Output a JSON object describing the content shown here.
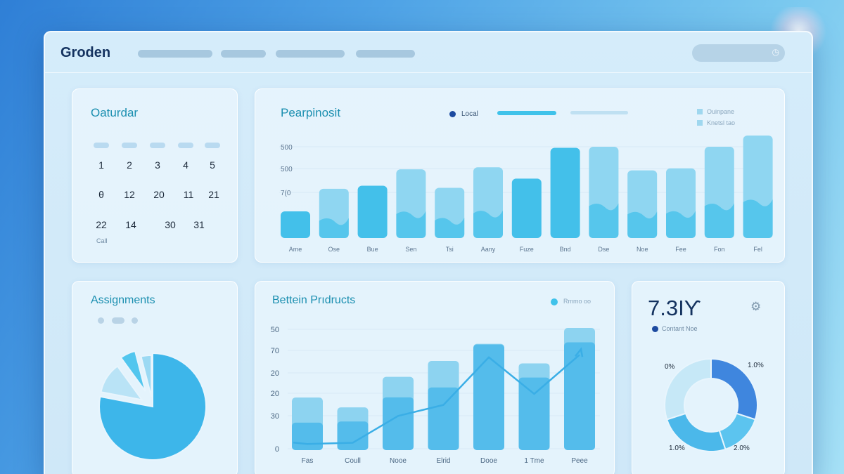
{
  "app": {
    "brand": "Groden"
  },
  "colors": {
    "accent": "#3fc2ea",
    "dark_dot": "#1c4aa0",
    "bar_light": "#8fd6f1",
    "bar_dark": "#43c0ea"
  },
  "calendar": {
    "title": "Oaturdar",
    "rows": [
      [
        "1",
        "2",
        "3",
        "4",
        "5"
      ],
      [
        "θ",
        "12",
        "20",
        "11",
        "21"
      ],
      [
        "22",
        "14",
        "30",
        "31"
      ]
    ],
    "footer": "Call"
  },
  "performance": {
    "title": "Pearpinosit",
    "legend_label": "Local",
    "legend_right": [
      "Ouinpane",
      "Knetsl tao"
    ]
  },
  "assignments": {
    "title": "Assignments"
  },
  "products": {
    "title": "Bettein Prıdructs",
    "legend_label": "Rmmo oo"
  },
  "stat": {
    "value": "7.3IƳ",
    "sublabel": "Contant Noe",
    "icon": "settings-icon",
    "donut_labels": {
      "top_left": "0%",
      "top_right": "1.0%",
      "bottom_left": "1.0%",
      "bottom_right": "2.0%"
    }
  },
  "chart_data": [
    {
      "type": "bar",
      "title": "Pearpinosit",
      "categories": [
        "Ame",
        "Ose",
        "Bue",
        "Sen",
        "Tsi",
        "Aany",
        "Fuze",
        "Bnd",
        "Dse",
        "Noe",
        "Fee",
        "Fon",
        "Fel"
      ],
      "y_tick_labels": [
        "500",
        "500",
        "7(0"
      ],
      "series": [
        {
          "values": [
            0.26,
            0.48,
            0.51,
            0.67,
            0.49,
            0.69,
            0.58,
            0.88,
            0.89,
            0.66,
            0.68,
            0.89,
            1.0
          ]
        }
      ]
    },
    {
      "type": "bar",
      "title": "Bettein Prıdructs",
      "categories": [
        "Fas",
        "Coull",
        "Nooe",
        "Elrid",
        "Dooe",
        "1 Tme",
        "Peee"
      ],
      "y_tick_labels": [
        "50",
        "70",
        "20",
        "20",
        "30",
        "0"
      ],
      "series": [
        {
          "values": [
            0.43,
            0.35,
            0.6,
            0.73,
            0.87,
            0.71,
            1.0
          ]
        },
        {
          "values": [
            0.05,
            0.06,
            0.28,
            0.37,
            0.76,
            0.46,
            0.78
          ]
        }
      ]
    },
    {
      "type": "pie",
      "title": "Assignments",
      "slices": [
        0.78,
        0.12,
        0.06,
        0.04
      ]
    },
    {
      "type": "pie",
      "title": "7.3IƳ",
      "slices": [
        0.3,
        0.15,
        0.25,
        0.3
      ]
    }
  ]
}
